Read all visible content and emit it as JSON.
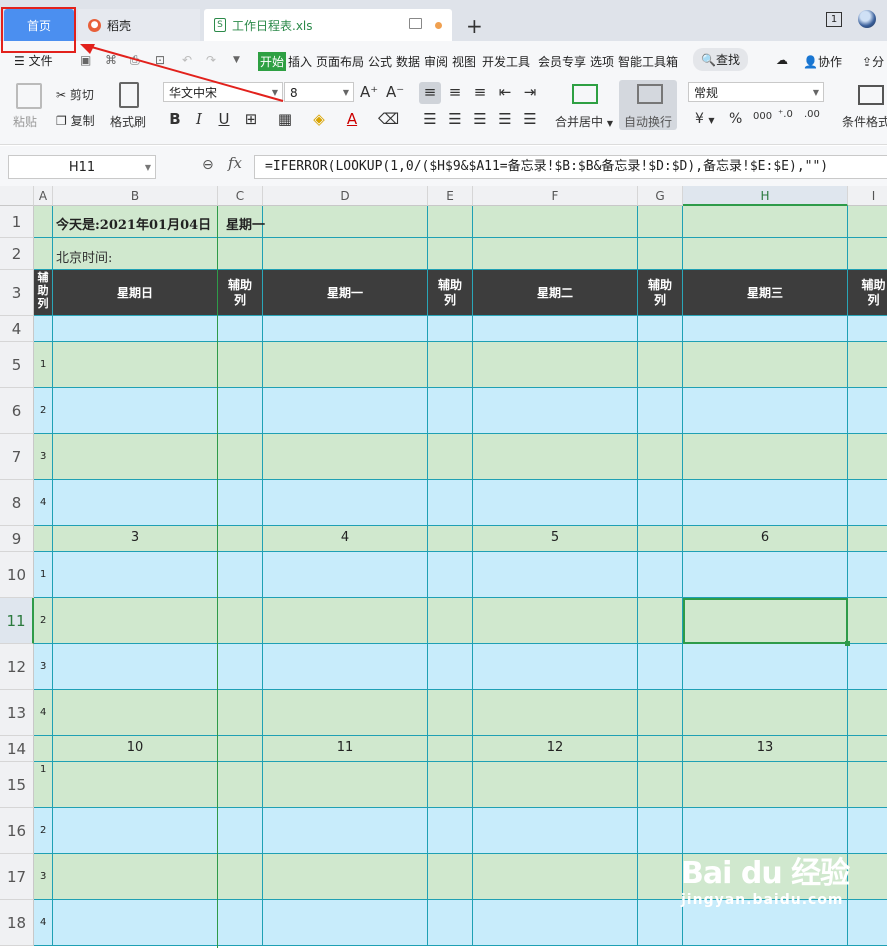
{
  "tabs": {
    "home": "首页",
    "docer": "稻壳",
    "file": "工作日程表.xls",
    "file_icon": "S",
    "new_tab": "+",
    "window_count": "1"
  },
  "menu": {
    "file": "文件",
    "items": [
      "开始",
      "插入",
      "页面布局",
      "公式",
      "数据",
      "审阅",
      "视图",
      "开发工具",
      "会员专享",
      "选项",
      "智能工具箱"
    ],
    "search": "查找",
    "collab": "协作",
    "share": "分"
  },
  "ribbon": {
    "paste": "粘贴",
    "cut": "剪切",
    "copy": "复制",
    "format_painter": "格式刷",
    "font_name": "华文中宋",
    "font_size": "8",
    "merge_center": "合并居中",
    "auto_wrap": "自动换行",
    "number_format": "常规",
    "conditional_format": "条件格式",
    "currency": "¥",
    "percent": "%",
    "thousands": "000"
  },
  "formula_bar": {
    "name_box": "H11",
    "fx": "fx",
    "formula": "=IFERROR(LOOKUP(1,0/($H$9&$A11=备忘录!$B:$B&备忘录!$D:$D),备忘录!$E:$E),\"\")"
  },
  "sheet": {
    "columns": [
      "A",
      "B",
      "C",
      "D",
      "E",
      "F",
      "G",
      "H",
      "I"
    ],
    "active_column": "H",
    "active_row": "11",
    "row_numbers": [
      "1",
      "2",
      "3",
      "4",
      "5",
      "6",
      "7",
      "8",
      "9",
      "10",
      "11",
      "12",
      "13",
      "14",
      "15",
      "16",
      "17",
      "18"
    ],
    "title": "今天是:2021年01月04日",
    "weekday": "星期一",
    "beijing_time": "北京时间:",
    "aux_label": "辅助列",
    "days": [
      "星期日",
      "星期一",
      "星期二",
      "星期三"
    ],
    "week1_dates": [
      "3",
      "4",
      "5",
      "6"
    ],
    "week2_dates": [
      "10",
      "11",
      "12",
      "13"
    ],
    "indices": [
      "1",
      "2",
      "3",
      "4"
    ]
  },
  "watermark": {
    "logo": "Bai du 经验",
    "url": "jingyan.baidu.com"
  },
  "colors": {
    "green_cell": "#d0e8ce",
    "blue_cell": "#c8ecfb",
    "header_dark": "#3d3d3d",
    "accent": "#2e9b49",
    "highlight": "#e2211c"
  }
}
